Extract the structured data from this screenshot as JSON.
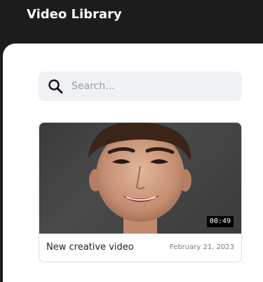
{
  "header": {
    "title": "Video Library"
  },
  "search": {
    "placeholder": "Search...",
    "value": "",
    "icon": "search-icon"
  },
  "videos": [
    {
      "title": "New creative video",
      "date": "February 21, 2023",
      "duration": "00:49"
    }
  ]
}
